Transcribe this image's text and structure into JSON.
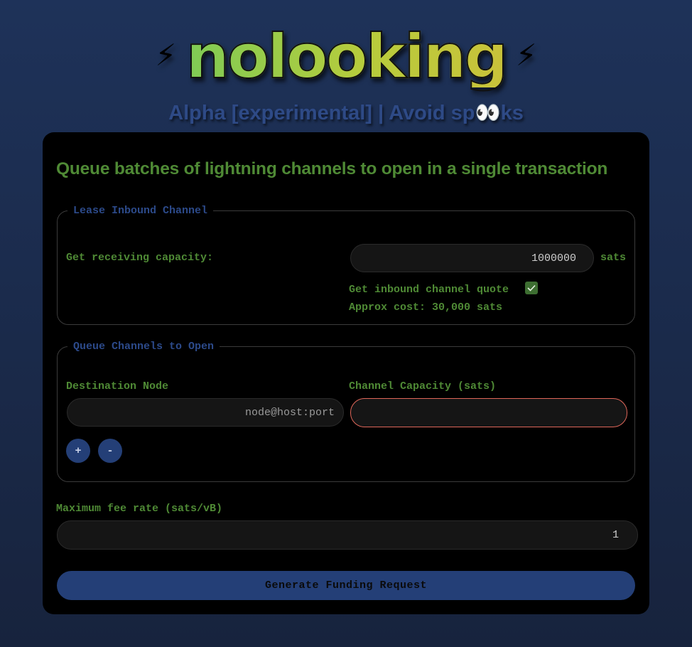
{
  "header": {
    "bolt": "⚡",
    "logo_text": "nolooking",
    "subtitle": "Alpha [experimental] | Avoid sp👀ks"
  },
  "main": {
    "heading": "Queue batches of lightning channels to open in a single transaction",
    "lease": {
      "legend": "Lease Inbound Channel",
      "capacity_label": "Get receiving capacity:",
      "capacity_value": "1000000",
      "unit": "sats",
      "quote_label": "Get inbound channel quote",
      "quote_checked": true,
      "approx_cost": "Approx cost: 30,000 sats"
    },
    "queue": {
      "legend": "Queue Channels to Open",
      "destination_label": "Destination Node",
      "destination_placeholder": "node@host:port",
      "capacity_label": "Channel Capacity (sats)",
      "capacity_value": "",
      "add_label": "+",
      "remove_label": "-"
    },
    "fee": {
      "label": "Maximum fee rate (sats/vB)",
      "value": "1"
    },
    "submit_label": "Generate Funding Request"
  },
  "colors": {
    "accent_green": "#4f8a35",
    "accent_blue": "#243f77",
    "error_border": "#e0675a"
  }
}
